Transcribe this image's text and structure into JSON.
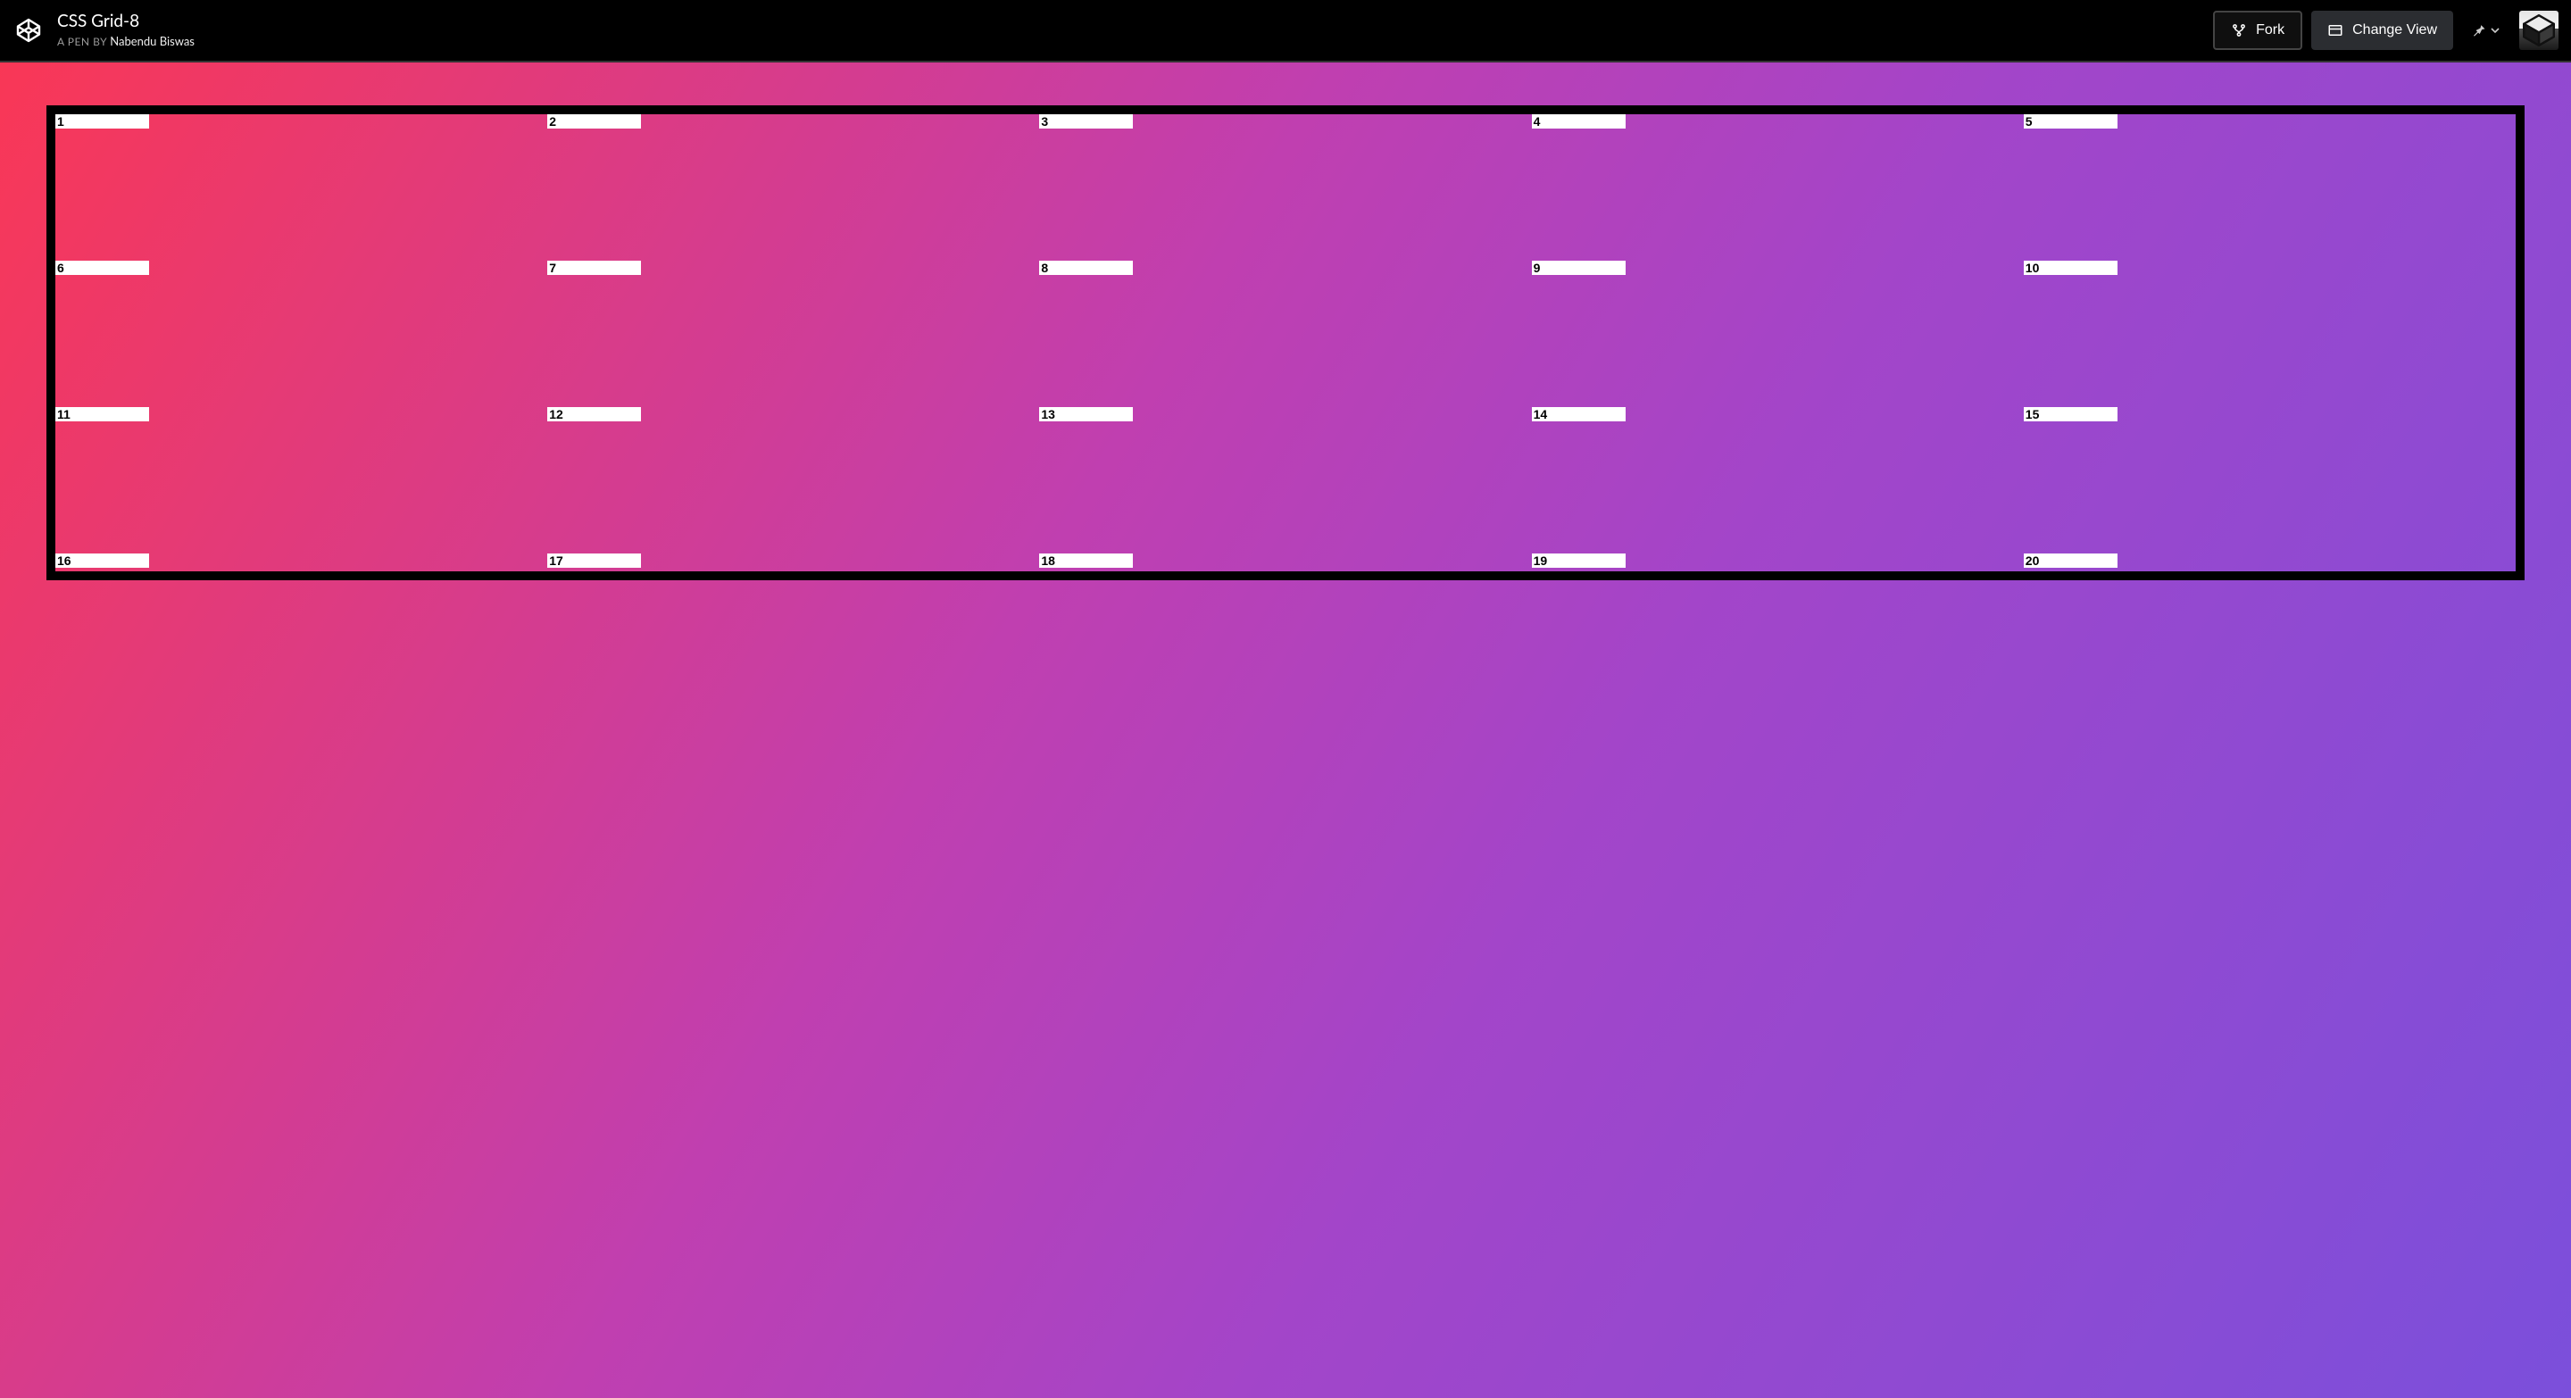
{
  "header": {
    "title": "CSS Grid-8",
    "sub_prefix": "A PEN BY",
    "author": "Nabendu Biswas",
    "fork_label": "Fork",
    "change_view_label": "Change View"
  },
  "grid": {
    "items": [
      "1",
      "2",
      "3",
      "4",
      "5",
      "6",
      "7",
      "8",
      "9",
      "10",
      "11",
      "12",
      "13",
      "14",
      "15",
      "16",
      "17",
      "18",
      "19",
      "20"
    ]
  }
}
